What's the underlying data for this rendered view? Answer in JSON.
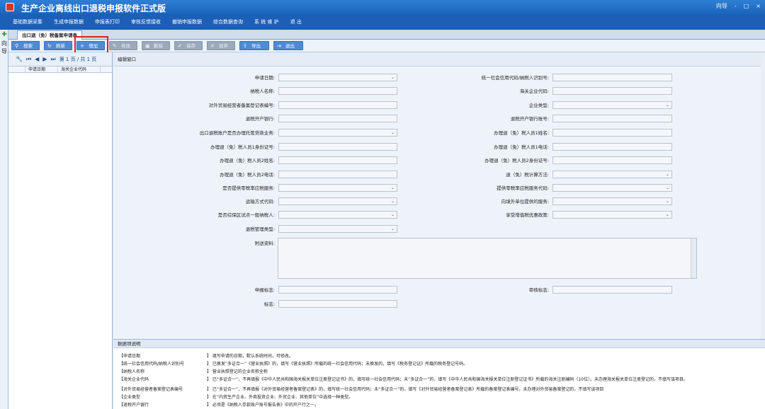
{
  "app": {
    "title": "生产企业离线出口退税申报软件正式版",
    "window_controls": [
      "向导",
      "-",
      "□",
      "×"
    ]
  },
  "menu": [
    "基础数据采集",
    "生成申报数据",
    "申报表打印",
    "审核反馈接收",
    "撤销申报数据",
    "综合数据查询",
    "系 统 维 护",
    "退 出"
  ],
  "rail": {
    "label_1": "向",
    "label_2": "导"
  },
  "tab": {
    "active": "出口退（免）税备案申请表"
  },
  "toolbar": {
    "search": "搜索",
    "refresh": "刷新",
    "add": "增加",
    "edit": "修改",
    "delete": "删除",
    "save": "保存",
    "cancel": "放弃",
    "import": "导出",
    "exit": "退出"
  },
  "pager": {
    "text": "第 1 页 / 共 1 页"
  },
  "list": {
    "columns": [
      "申请日期",
      "海关企业代码"
    ]
  },
  "edit": {
    "header": "编辑窗口"
  },
  "form": {
    "apply_date": "申请日期:",
    "credit_code": "统一社会信用代码/纳税人识别号:",
    "taxpayer_name": "纳税人名称:",
    "customs_code": "海关企业代码:",
    "trade_reg_no": "对外贸易经营者备案登记表编号:",
    "company_type": "企业类型:",
    "refund_bank": "退税开户银行:",
    "refund_account": "退税开户银行账号:",
    "entrust_loan": "出口退税账户是否办理托管贷款业务:",
    "handler1_name": "办理退（免）税人员1姓名:",
    "handler1_id": "办理退（免）税人员1身份证号:",
    "handler1_phone": "办理退（免）税人员1电话:",
    "handler2_name": "办理退（免）税人员2姓名:",
    "handler2_id": "办理退（免）税人员2身份证号:",
    "handler2_phone": "办理退（免）税人员2电话:",
    "calc_method": "退（免）税计算方法:",
    "zero_rate_service": "是否提供零税率应税服务:",
    "zero_rate_code": "提供零税率应税服务代码:",
    "transport_code": "运输方式代码:",
    "overseas_service": "向境外单位提供的服务:",
    "pilot_general": "是否综保区试点一般纳税人:",
    "vat_policy": "享受增值税优惠政策:",
    "refund_mgmt_type": "退税管理类型:",
    "remarks": "附送资料:",
    "report_flag": "申报标志:",
    "audit_flag": "审核标志:",
    "flag": "标志:"
  },
  "desc": {
    "header": "数据项说明",
    "rows": [
      {
        "k": "【申请日期",
        "v": "】 填写申请的日期，默认系统时间，可修改。"
      },
      {
        "k": "【统一社会信用代码/纳税人识别号",
        "v": "】 已换发“多证合一”《营业执照》的，填写《营业执照》所载的统一社会信用代码；未换发的，填写《税务登记证》所载的税务登记号码。"
      },
      {
        "k": "【纳税人名称",
        "v": "】 营业执照登记的企业名称全称"
      },
      {
        "k": "【海关企业代码",
        "v": "】 已“多证合一”，不再填报《中华人民共和国海关报关单位注册登记证书》的，填写统一社会信用代码；未“多证合一”的，填写《中华人民共和国海关报关单位注册登记证书》所载的海关注册编码（10位）。未办理海关报关单位注册登记的，不填写该项目。"
      },
      {
        "k": "【对外贸易经营者备案登记表编号",
        "v": "】 已“多证合一”，不再填报《对外贸易经营者备案登记表》的，填写统一社会信用代码；未“多证合一”的，填写《对外贸易经营者备案登记表》所载的备案登记表编号。未办理对外贸易备案登记的，不填写该项目"
      },
      {
        "k": "【企业类型",
        "v": "】 在“内资生产企业、外商投资企业、外贸企业、其他单位”中选择一种类型。"
      },
      {
        "k": "【退税开户银行",
        "v": "】 必须是《纳税人存款账户账号报告表》中的开户行之一。"
      }
    ]
  }
}
